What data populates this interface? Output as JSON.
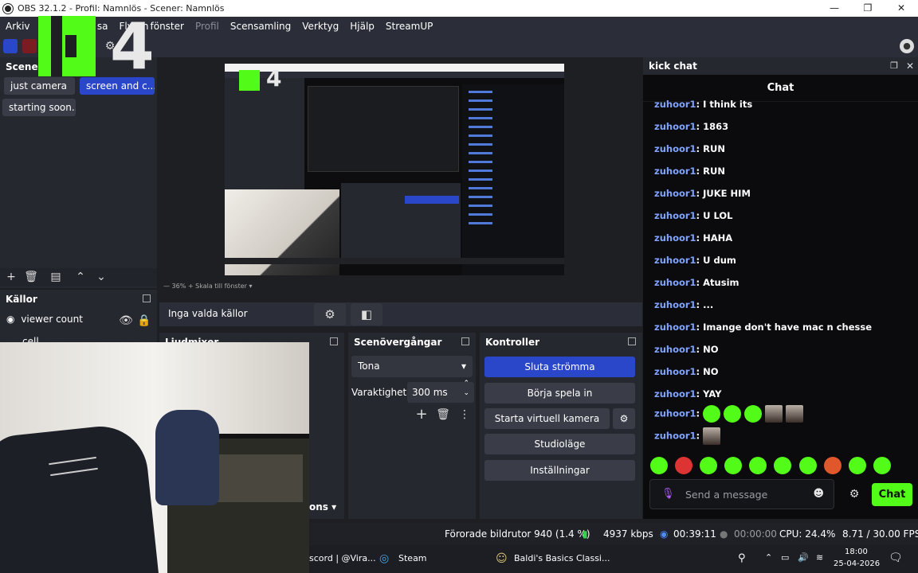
{
  "window": {
    "title": "OBS 32.1.2 - Profil: Namnlös - Scener: Namnlös",
    "controls": [
      "—",
      "❐",
      "✕"
    ]
  },
  "menu": {
    "items": [
      "Arkiv",
      "R",
      "sa",
      "Flytan",
      "fönster",
      "Profil",
      "Scensamling",
      "Verktyg",
      "Hjälp",
      "StreamUP"
    ]
  },
  "scenes": {
    "title": "Scener",
    "items": [
      {
        "label": "just camera",
        "active": false
      },
      {
        "label": "screen and c...",
        "active": true
      },
      {
        "label": "starting soon...",
        "active": false
      }
    ]
  },
  "preview": {
    "zoom": "36%",
    "scale_label": "Skala till fönster"
  },
  "sources": {
    "title": "Källor",
    "items": [
      {
        "label": "viewer count"
      },
      {
        "label": "cell"
      }
    ],
    "none_selected": "Inga valda källor"
  },
  "audio_mixer": {
    "title": "Ljudmixer",
    "footer_label": "ons"
  },
  "transitions": {
    "title": "Scenövergångar",
    "type": "Tona",
    "duration_label": "Varaktighet",
    "duration_value": "300 ms"
  },
  "controls": {
    "title": "Kontroller",
    "stop_stream": "Sluta strömma",
    "start_record": "Börja spela in",
    "virtual_camera": "Starta virtuell kamera",
    "studio_mode": "Studioläge",
    "settings": "Inställningar"
  },
  "chat_dock": {
    "title": "kick chat",
    "header": "Chat",
    "messages": [
      {
        "user": "zuhoor1",
        "text": ": I think its"
      },
      {
        "user": "zuhoor1",
        "text": ": 1863"
      },
      {
        "user": "zuhoor1",
        "text": ": RUN"
      },
      {
        "user": "zuhoor1",
        "text": ": RUN"
      },
      {
        "user": "zuhoor1",
        "text": ": JUKE HIM"
      },
      {
        "user": "zuhoor1",
        "text": ": U LOL"
      },
      {
        "user": "zuhoor1",
        "text": ": HAHA"
      },
      {
        "user": "zuhoor1",
        "text": ": U dum"
      },
      {
        "user": "zuhoor1",
        "text": ": Atusim"
      },
      {
        "user": "zuhoor1",
        "text": ": ..."
      },
      {
        "user": "zuhoor1",
        "text": ": Imange don't have mac n chesse"
      },
      {
        "user": "zuhoor1",
        "text": ": NO"
      },
      {
        "user": "zuhoor1",
        "text": ": NO"
      },
      {
        "user": "zuhoor1",
        "text": ": YAY"
      },
      {
        "user": "zuhoor1",
        "text": ":"
      },
      {
        "user": "zuhoor1",
        "text": ":"
      }
    ],
    "input_placeholder": "Send a message",
    "send_label": "Chat"
  },
  "status_bar": {
    "dropped_frames": "Förorade bildrutor 940 (1.4 %)",
    "bitrate": "4937 kbps",
    "stream_time": "00:39:11",
    "record_time": "00:00:00",
    "cpu": "CPU: 24.4%",
    "fps": "8.71 / 30.00 FPS"
  },
  "taskbar": {
    "discord": "scord | @Vira...",
    "steam": "Steam",
    "game": "Baldi's Basics Classi...",
    "time": "18:00",
    "date": "25-04-2026"
  },
  "overlay": {
    "logo_text": "4"
  },
  "colors": {
    "accent_blue": "#2a46c9",
    "kick_green": "#53fc18",
    "username_blue": "#7fa4ff",
    "dock_bg": "#262830"
  }
}
